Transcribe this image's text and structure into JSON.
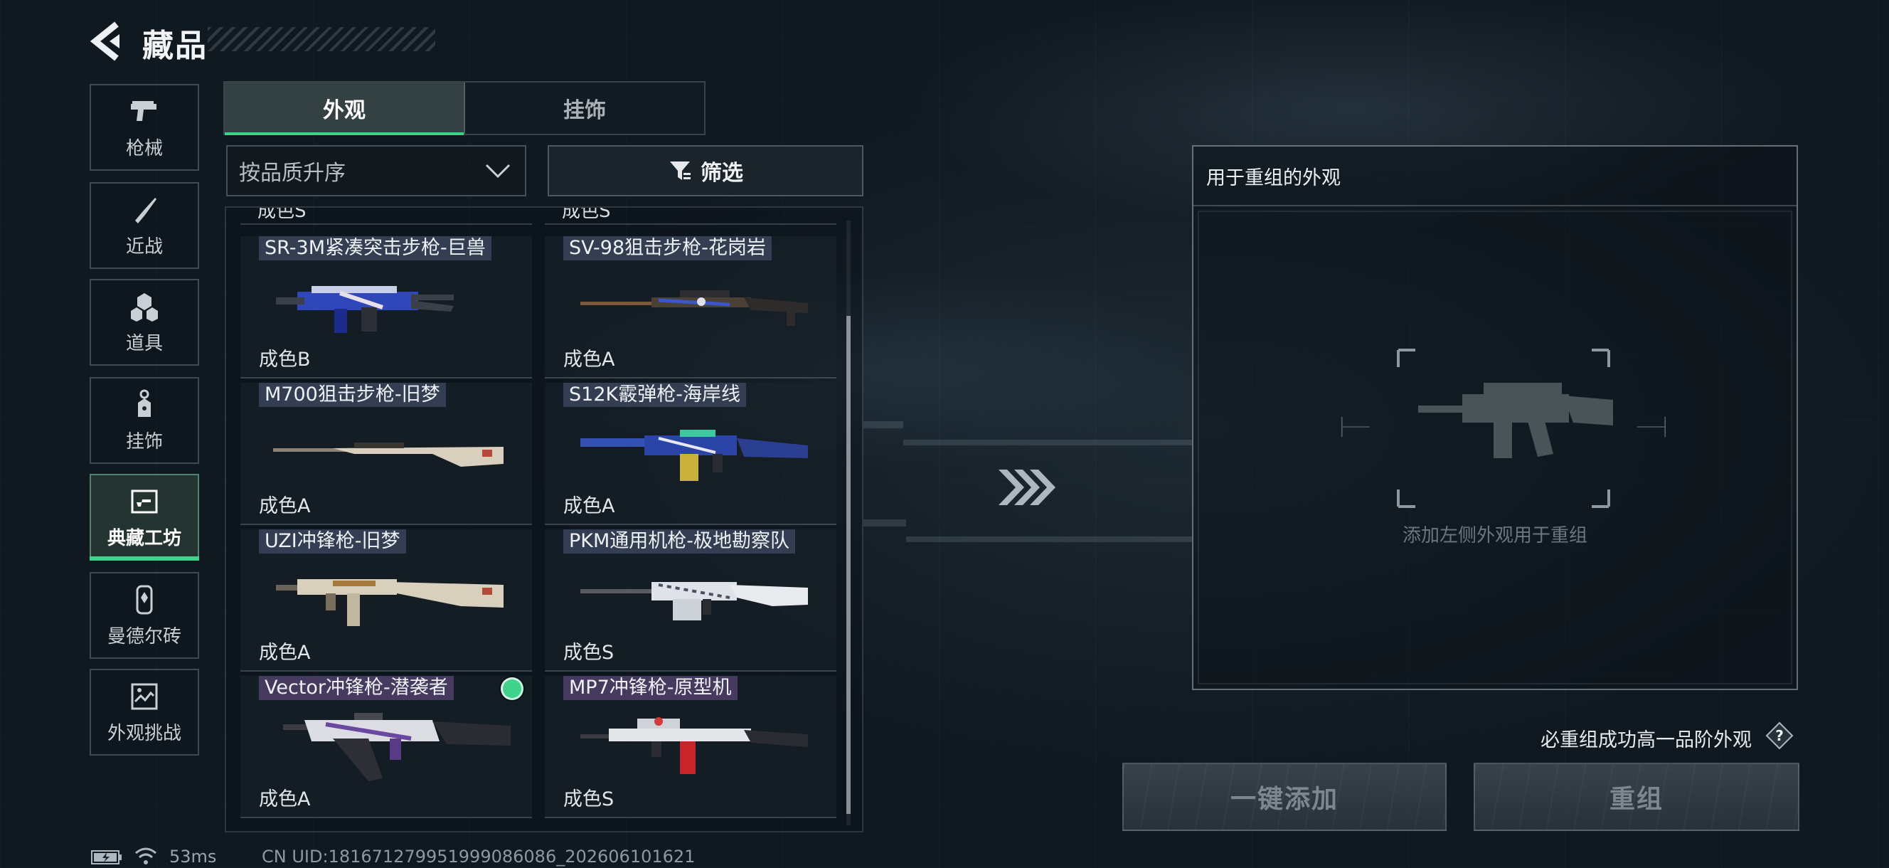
{
  "header": {
    "title": "藏品"
  },
  "sidebar": {
    "items": [
      {
        "label": "枪械",
        "icon": "pistol-icon"
      },
      {
        "label": "近战",
        "icon": "knife-icon"
      },
      {
        "label": "道具",
        "icon": "grenade-icon"
      },
      {
        "label": "挂饰",
        "icon": "charm-icon"
      },
      {
        "label": "典藏工坊",
        "icon": "workshop-icon",
        "active": true
      },
      {
        "label": "曼德尔砖",
        "icon": "brick-icon"
      },
      {
        "label": "外观挑战",
        "icon": "challenge-icon"
      }
    ]
  },
  "tabs": [
    {
      "label": "外观",
      "active": true
    },
    {
      "label": "挂饰",
      "active": false
    }
  ],
  "sort": {
    "value": "按品质升序"
  },
  "filter": {
    "label": "筛选"
  },
  "list": {
    "peek": [
      "成色S",
      "成色S"
    ],
    "items": [
      {
        "name": "SR-3M紧凑突击步枪-巨兽",
        "grade": "成色B"
      },
      {
        "name": "SV-98狙击步枪-花岗岩",
        "grade": "成色A"
      },
      {
        "name": "M700狙击步枪-旧梦",
        "grade": "成色A"
      },
      {
        "name": "S12K霰弹枪-海岸线",
        "grade": "成色A"
      },
      {
        "name": "UZI冲锋枪-旧梦",
        "grade": "成色A"
      },
      {
        "name": "PKM通用机枪-极地勘察队",
        "grade": "成色S"
      },
      {
        "name": "Vector冲锋枪-潜袭者",
        "grade": "成色A",
        "selected": true
      },
      {
        "name": "MP7冲锋枪-原型机",
        "grade": "成色S"
      }
    ]
  },
  "recombine_panel": {
    "title": "用于重组的外观",
    "empty_hint": "添加左侧外观用于重组"
  },
  "guarantee_text": "必重组成功高一品阶外观",
  "buttons": {
    "one_key_add": "一键添加",
    "recombine": "重组"
  },
  "status": {
    "ping": "53ms",
    "uid": "CN UID:1816712799519990860​86_202606101621"
  },
  "colors": {
    "accent": "#3ed28a",
    "panel_border": "#c8d2d7"
  }
}
